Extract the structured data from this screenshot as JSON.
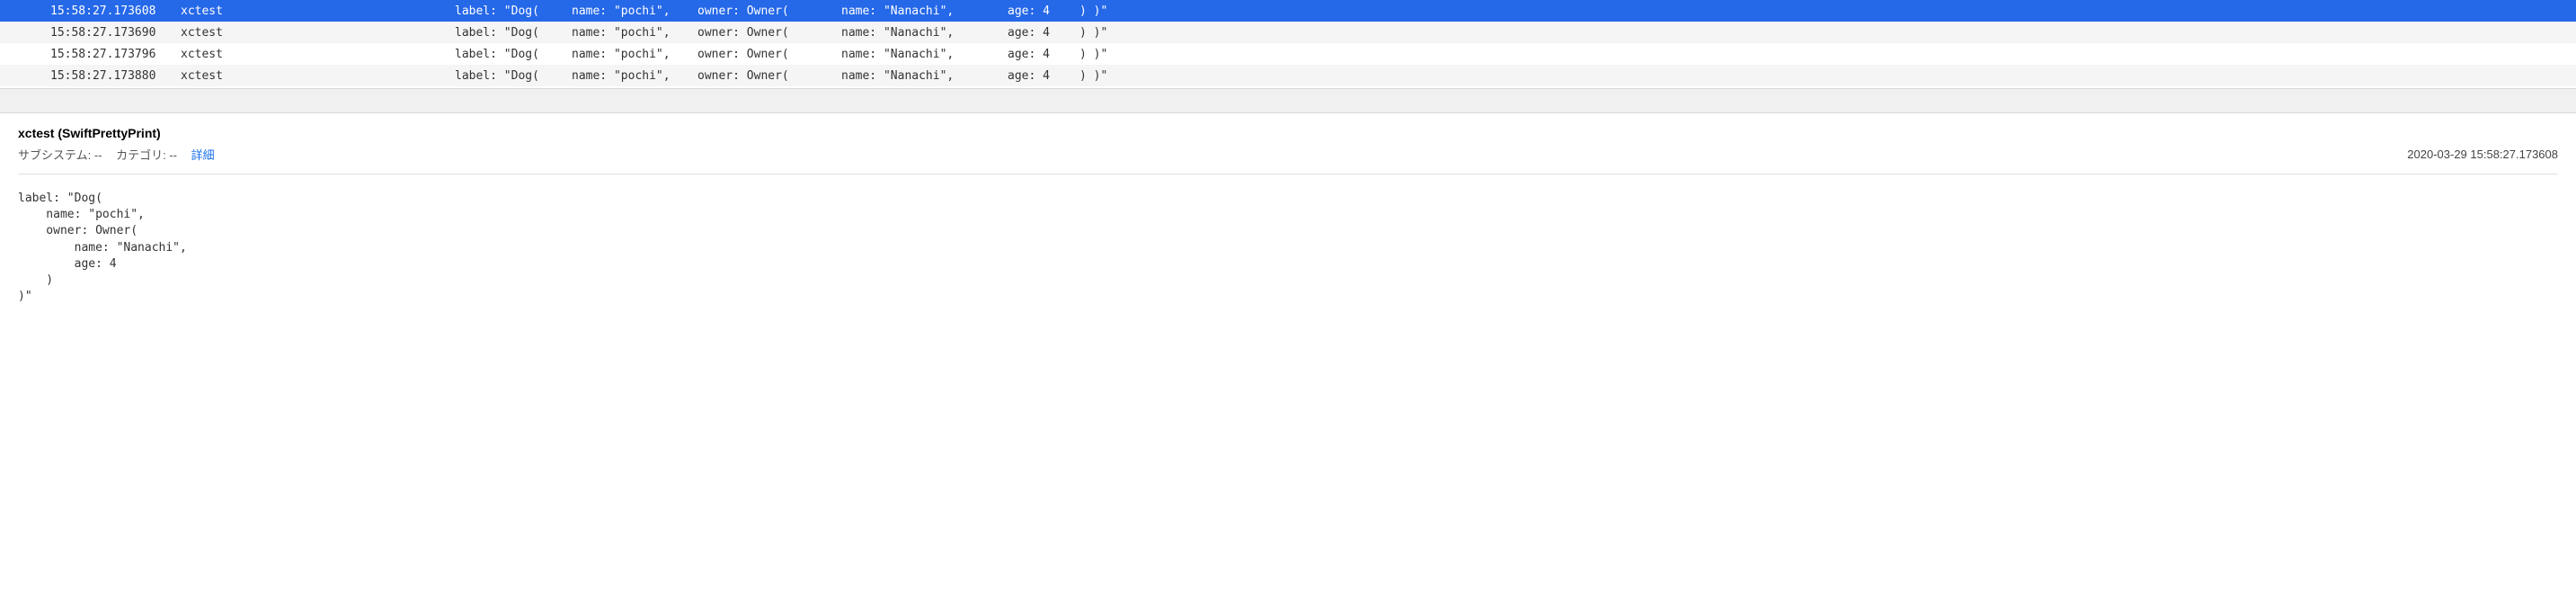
{
  "log_rows": [
    {
      "time": "15:58:27.173608",
      "process": "xctest",
      "label": "label: \"Dog(",
      "name_col": "name: \"pochi\",",
      "owner_col": "owner: Owner(",
      "ownername_col": "name: \"Nanachi\",",
      "age_col": "age: 4",
      "close_col": ") )\"",
      "selected": true
    },
    {
      "time": "15:58:27.173690",
      "process": "xctest",
      "label": "label: \"Dog(",
      "name_col": "name: \"pochi\",",
      "owner_col": "owner: Owner(",
      "ownername_col": "name: \"Nanachi\",",
      "age_col": "age: 4",
      "close_col": ") )\"",
      "selected": false
    },
    {
      "time": "15:58:27.173796",
      "process": "xctest",
      "label": "label: \"Dog(",
      "name_col": "name: \"pochi\",",
      "owner_col": "owner: Owner(",
      "ownername_col": "name: \"Nanachi\",",
      "age_col": "age: 4",
      "close_col": ") )\"",
      "selected": false
    },
    {
      "time": "15:58:27.173880",
      "process": "xctest",
      "label": "label: \"Dog(",
      "name_col": "name: \"pochi\",",
      "owner_col": "owner: Owner(",
      "ownername_col": "name: \"Nanachi\",",
      "age_col": "age: 4",
      "close_col": ") )\"",
      "selected": false
    }
  ],
  "detail": {
    "title": "xctest (SwiftPrettyPrint)",
    "subsystem_label": "サブシステム: --",
    "category_label": "カテゴリ: --",
    "link_text": "詳細",
    "timestamp": "2020-03-29 15:58:27.173608",
    "body": "label: \"Dog(\n    name: \"pochi\",\n    owner: Owner(\n        name: \"Nanachi\",\n        age: 4\n    )\n)\""
  }
}
